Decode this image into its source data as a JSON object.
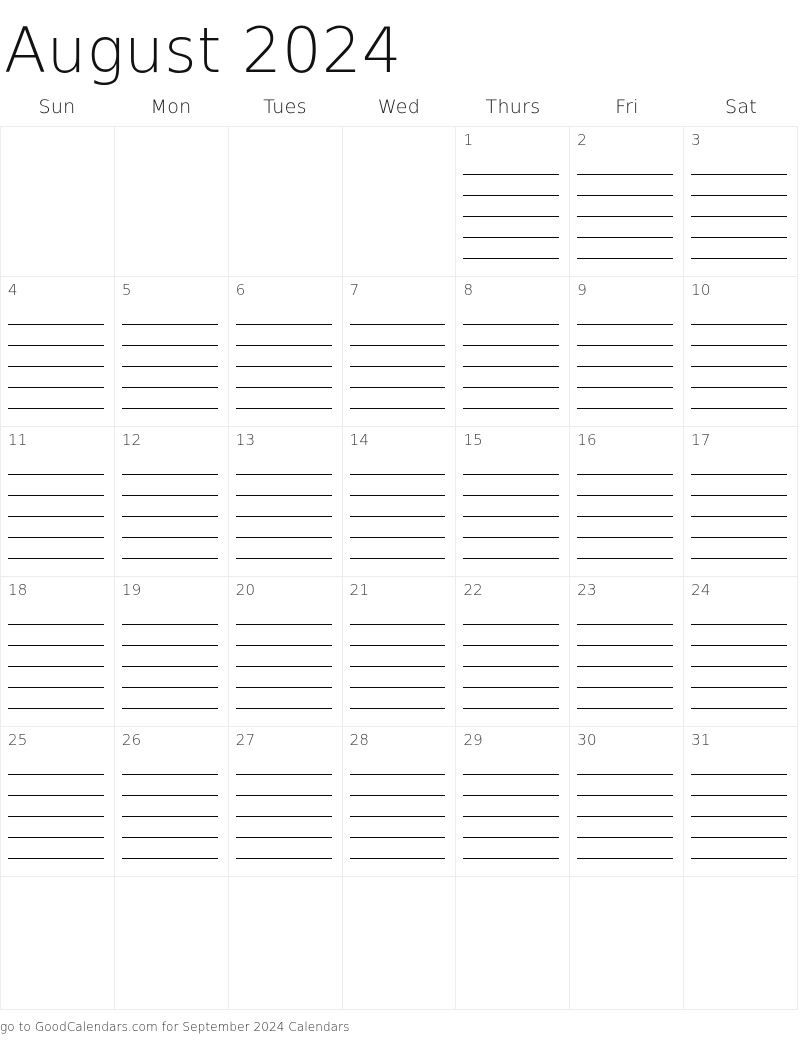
{
  "page": {
    "title": "August 2024",
    "month": "August",
    "year": "2024",
    "background_color": "#ffffff",
    "grid_line_color": "#ececec",
    "rule_line_color": "#0a0a0a",
    "text_color": "#111111"
  },
  "weekdays": [
    {
      "label": "Sun"
    },
    {
      "label": "Mon"
    },
    {
      "label": "Tues"
    },
    {
      "label": "Wed"
    },
    {
      "label": "Thurs"
    },
    {
      "label": "Fri"
    },
    {
      "label": "Sat"
    }
  ],
  "lines_per_day": 6,
  "weeks": [
    {
      "days": [
        {
          "date": "",
          "empty": true
        },
        {
          "date": "",
          "empty": true
        },
        {
          "date": "",
          "empty": true
        },
        {
          "date": "",
          "empty": true
        },
        {
          "date": "1",
          "empty": false
        },
        {
          "date": "2",
          "empty": false
        },
        {
          "date": "3",
          "empty": false
        }
      ]
    },
    {
      "days": [
        {
          "date": "4",
          "empty": false
        },
        {
          "date": "5",
          "empty": false
        },
        {
          "date": "6",
          "empty": false
        },
        {
          "date": "7",
          "empty": false
        },
        {
          "date": "8",
          "empty": false
        },
        {
          "date": "9",
          "empty": false
        },
        {
          "date": "10",
          "empty": false
        }
      ]
    },
    {
      "days": [
        {
          "date": "11",
          "empty": false
        },
        {
          "date": "12",
          "empty": false
        },
        {
          "date": "13",
          "empty": false
        },
        {
          "date": "14",
          "empty": false
        },
        {
          "date": "15",
          "empty": false
        },
        {
          "date": "16",
          "empty": false
        },
        {
          "date": "17",
          "empty": false
        }
      ]
    },
    {
      "days": [
        {
          "date": "18",
          "empty": false
        },
        {
          "date": "19",
          "empty": false
        },
        {
          "date": "20",
          "empty": false
        },
        {
          "date": "21",
          "empty": false
        },
        {
          "date": "22",
          "empty": false
        },
        {
          "date": "23",
          "empty": false
        },
        {
          "date": "24",
          "empty": false
        }
      ]
    },
    {
      "days": [
        {
          "date": "25",
          "empty": false
        },
        {
          "date": "26",
          "empty": false
        },
        {
          "date": "27",
          "empty": false
        },
        {
          "date": "28",
          "empty": false
        },
        {
          "date": "29",
          "empty": false
        },
        {
          "date": "30",
          "empty": false
        },
        {
          "date": "31",
          "empty": false
        }
      ]
    },
    {
      "days": [
        {
          "date": "",
          "empty": true
        },
        {
          "date": "",
          "empty": true
        },
        {
          "date": "",
          "empty": true
        },
        {
          "date": "",
          "empty": true
        },
        {
          "date": "",
          "empty": true
        },
        {
          "date": "",
          "empty": true
        },
        {
          "date": "",
          "empty": true
        }
      ]
    }
  ],
  "footer": {
    "text": "go to GoodCalendars.com for September 2024 Calendars"
  }
}
